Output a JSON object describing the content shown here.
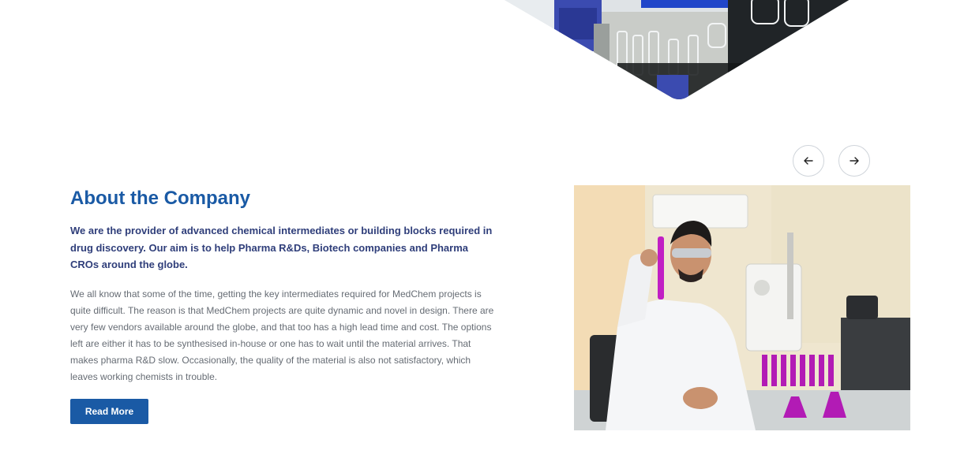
{
  "about": {
    "title": "About the Company",
    "lead": "We are the provider of advanced chemical intermediates or building blocks required in drug discovery. Our aim is to help Pharma R&Ds, Biotech companies and Pharma CROs around the globe.",
    "body": "We all know that some of the time, getting the key intermediates required for MedChem projects is quite difficult. The reason is that MedChem projects are quite dynamic and novel in design. There are very few vendors available around the globe, and that too has a high lead time and cost. The options left are either it has to be synthesised in-house or one has to wait until the material arrives. That makes pharma R&D slow. Occasionally, the quality of the material is also not satisfactory, which leaves working chemists in trouble.",
    "button_label": "Read More"
  },
  "carousel": {
    "prev_icon": "arrow-left-icon",
    "next_icon": "arrow-right-icon"
  },
  "colors": {
    "accent": "#1a5aa5",
    "lead_text": "#2f3e7a",
    "body_text": "#666c74"
  }
}
